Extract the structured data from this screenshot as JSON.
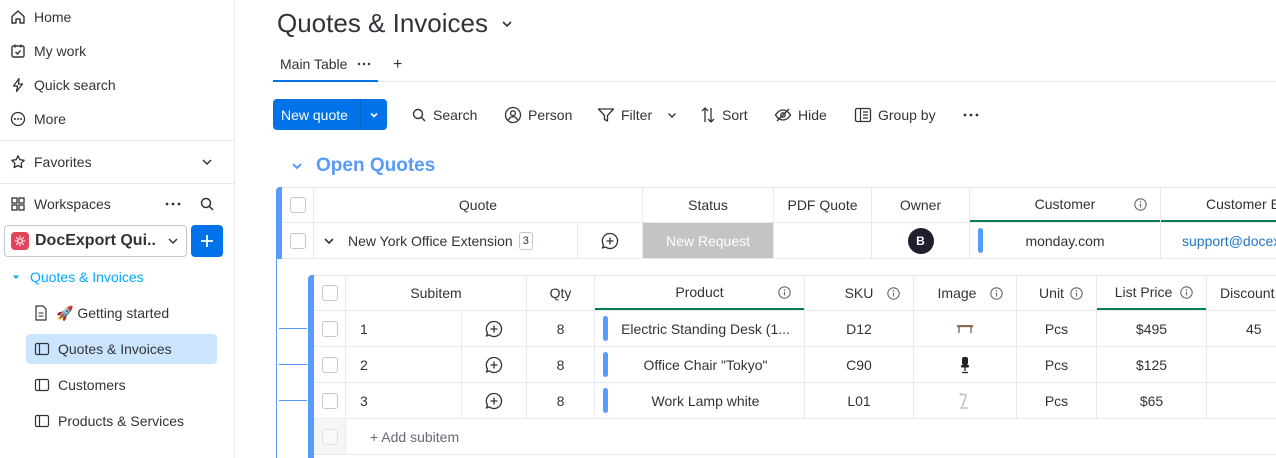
{
  "sidebar": {
    "nav": [
      {
        "label": "Home",
        "icon": "home-icon"
      },
      {
        "label": "My work",
        "icon": "calendar-check-icon"
      },
      {
        "label": "Quick search",
        "icon": "lightning-icon"
      },
      {
        "label": "More",
        "icon": "more-circle-icon"
      }
    ],
    "favorites_label": "Favorites",
    "workspaces_label": "Workspaces",
    "workspace_name": "DocExport Qui...",
    "tree": [
      {
        "label": "Quotes & Invoices",
        "type": "folder-root"
      },
      {
        "label": "🚀 Getting started",
        "type": "doc"
      },
      {
        "label": "Quotes & Invoices",
        "type": "board",
        "active": true
      },
      {
        "label": "Customers",
        "type": "board"
      },
      {
        "label": "Products & Services",
        "type": "board"
      }
    ]
  },
  "header": {
    "title": "Quotes & Invoices",
    "view_tab": "Main Table",
    "add_view": "+"
  },
  "toolbar": {
    "new_label": "New quote",
    "search": "Search",
    "person": "Person",
    "filter": "Filter",
    "sort": "Sort",
    "hide": "Hide",
    "group_by": "Group by"
  },
  "group": {
    "title": "Open Quotes",
    "color": "#579bfc"
  },
  "main_table": {
    "columns": {
      "quote": "Quote",
      "status": "Status",
      "pdf": "PDF Quote",
      "owner": "Owner",
      "customer": "Customer",
      "customer_email": "Customer E"
    },
    "row": {
      "name": "New York Office Extension",
      "subitem_count": "3",
      "status": "New Request",
      "owner_initial": "B",
      "customer": "monday.com",
      "customer_email": "support@docex"
    }
  },
  "subitems": {
    "columns": {
      "subitem": "Subitem",
      "qty": "Qty",
      "product": "Product",
      "sku": "SKU",
      "image": "Image",
      "unit": "Unit",
      "list_price": "List Price",
      "discount": "Discount"
    },
    "rows": [
      {
        "name": "1",
        "qty": "8",
        "product": "Electric Standing Desk (1...",
        "sku": "D12",
        "unit": "Pcs",
        "price": "$495",
        "discount": "45"
      },
      {
        "name": "2",
        "qty": "8",
        "product": "Office Chair \"Tokyo\"",
        "sku": "C90",
        "unit": "Pcs",
        "price": "$125",
        "discount": ""
      },
      {
        "name": "3",
        "qty": "8",
        "product": "Work Lamp white",
        "sku": "L01",
        "unit": "Pcs",
        "price": "$65",
        "discount": ""
      }
    ],
    "add_label": "+ Add subitem"
  }
}
